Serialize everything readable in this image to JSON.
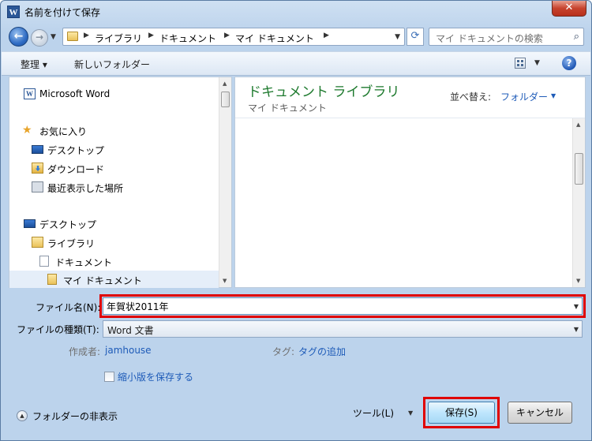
{
  "window": {
    "title": "名前を付けて保存",
    "app_icon_letter": "W",
    "close_glyph": "✕"
  },
  "address": {
    "breadcrumbs": [
      "ライブラリ",
      "ドキュメント",
      "マイ ドキュメント"
    ],
    "search_placeholder": "マイ ドキュメントの検索"
  },
  "toolbar": {
    "organize_label": "整理 ▾",
    "new_folder_label": "新しいフォルダー"
  },
  "nav": {
    "items": [
      {
        "label": "Microsoft Word",
        "icon": "word-icon"
      },
      {
        "label": "お気に入り",
        "icon": "star-icon"
      },
      {
        "label": "デスクトップ",
        "icon": "desktop-icon"
      },
      {
        "label": "ダウンロード",
        "icon": "downloads-icon"
      },
      {
        "label": "最近表示した場所",
        "icon": "recent-places-icon"
      },
      {
        "label": "デスクトップ",
        "icon": "desktop-icon"
      },
      {
        "label": "ライブラリ",
        "icon": "library-icon"
      },
      {
        "label": "ドキュメント",
        "icon": "document-icon"
      },
      {
        "label": "マイ ドキュメント",
        "icon": "folder-icon"
      }
    ]
  },
  "content": {
    "library_title": "ドキュメント ライブラリ",
    "library_subtitle": "マイ ドキュメント",
    "sort_label": "並べ替え:",
    "sort_value": "フォルダー"
  },
  "form": {
    "filename_label": "ファイル名(N):",
    "filename_value": "年賀状2011年",
    "filetype_label": "ファイルの種類(T):",
    "filetype_value": "Word 文書",
    "author_label": "作成者:",
    "author_value": "jamhouse",
    "tags_label": "タグ:",
    "tags_value": "タグの追加",
    "thumbnail_label": "縮小版を保存する",
    "hide_folders_label": "フォルダーの非表示",
    "tools_label": "ツール(L)",
    "save_label": "保存(S)",
    "cancel_label": "キャンセル"
  },
  "colors": {
    "highlight": "#e00000",
    "library_title": "#1e7a2e",
    "link": "#1e5bb8"
  }
}
